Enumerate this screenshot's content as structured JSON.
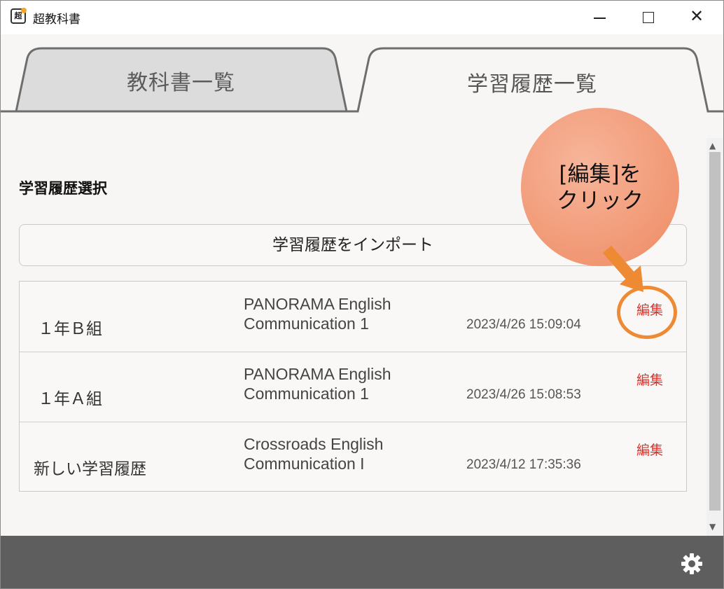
{
  "window": {
    "app_title": "超教科書",
    "app_icon_text": "超"
  },
  "tabs": [
    {
      "label": "教科書一覧",
      "active": false
    },
    {
      "label": "学習履歴一覧",
      "active": true
    }
  ],
  "section_title": "学習履歴選択",
  "import_button_label": "学習履歴をインポート",
  "history": [
    {
      "name": "１年Ｂ組",
      "book_line1": "PANORAMA English",
      "book_line2": "Communication 1",
      "date": "2023/4/26 15:09:04",
      "edit_label": "編集"
    },
    {
      "name": "１年Ａ組",
      "book_line1": "PANORAMA English",
      "book_line2": "Communication 1",
      "date": "2023/4/26 15:08:53",
      "edit_label": "編集"
    },
    {
      "name": "新しい学習履歴",
      "book_line1": "Crossroads English",
      "book_line2": "Communication I",
      "date": "2023/4/12 17:35:36",
      "edit_label": "編集"
    }
  ],
  "annotation": {
    "line1": "[編集]を",
    "line2": "クリック"
  },
  "colors": {
    "accent_orange": "#ee8a33",
    "edit_red": "#e0302a",
    "footer_gray": "#5e5e5e"
  },
  "icons": [
    "app-icon",
    "minimize-icon",
    "maximize-icon",
    "close-icon",
    "gear-icon",
    "scroll-up-icon",
    "scroll-down-icon"
  ]
}
